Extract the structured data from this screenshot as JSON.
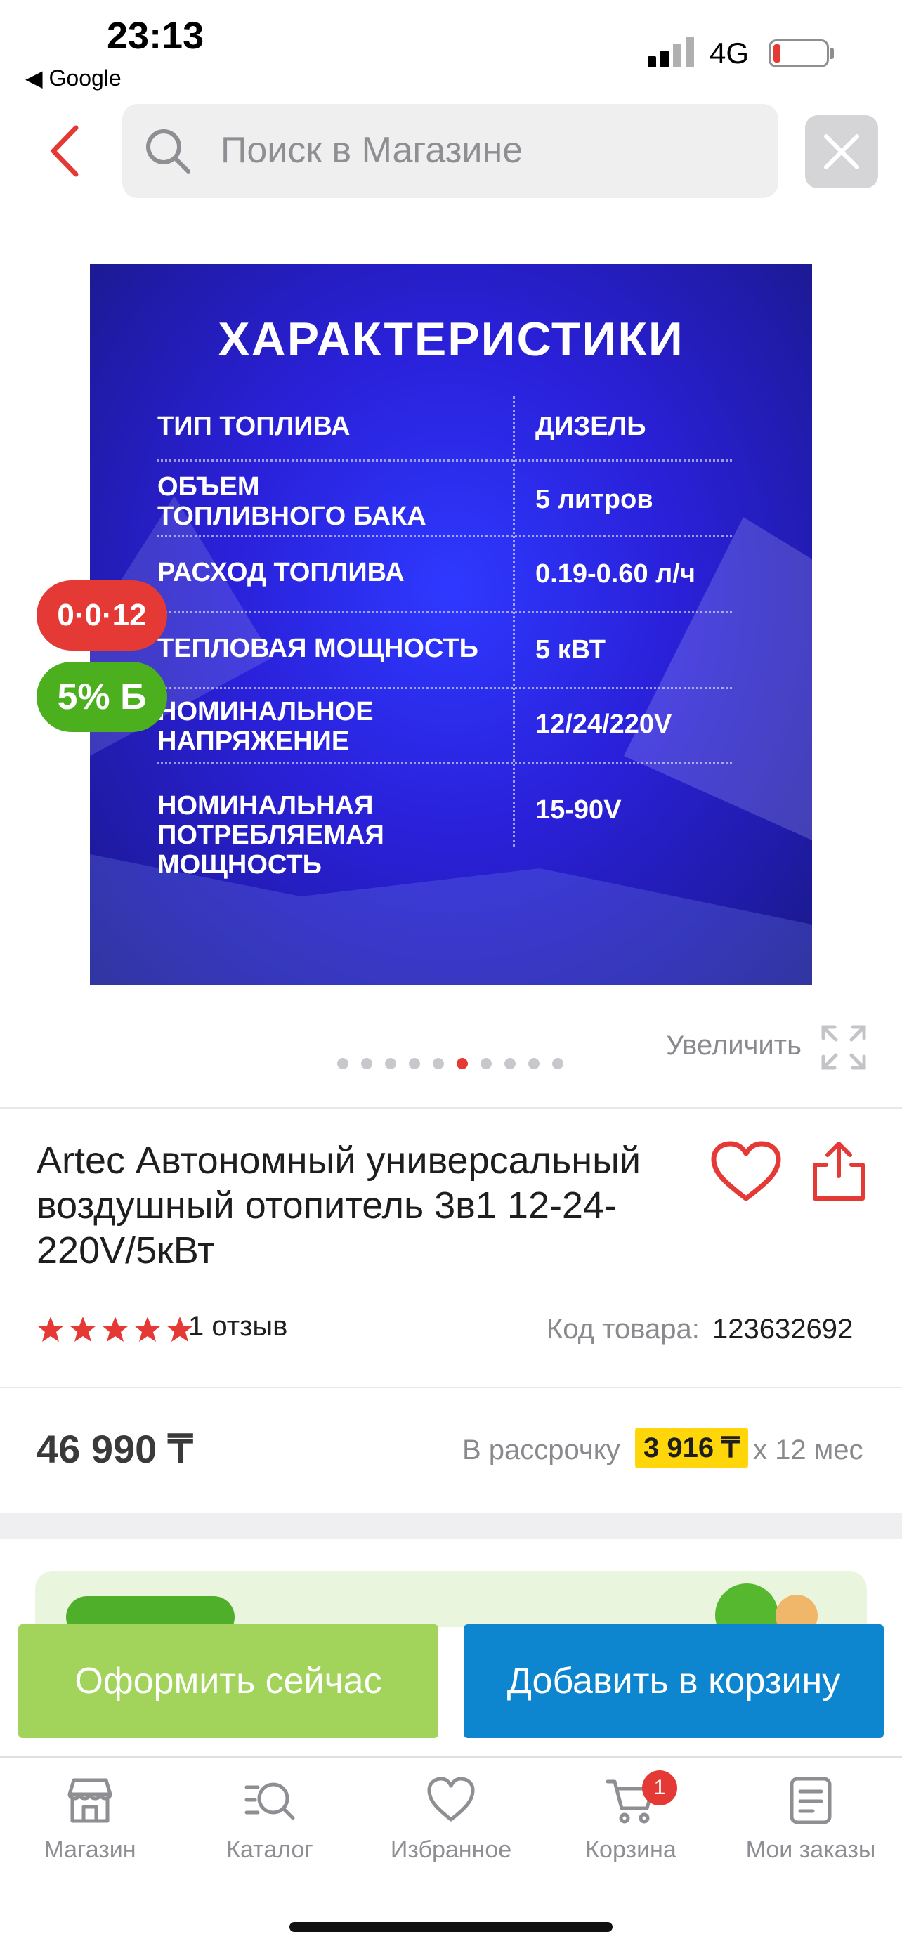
{
  "status_bar": {
    "time": "23:13",
    "back_app": "◀ Google",
    "network": "4G"
  },
  "search": {
    "placeholder": "Поиск в Магазине"
  },
  "product_image": {
    "title": "ХАРАКТЕРИСТИКИ",
    "specs": [
      {
        "name": "ТИП ТОПЛИВА",
        "value": "ДИЗЕЛЬ"
      },
      {
        "name": "ОБЪЕМ\nТОПЛИВНОГО БАКА",
        "value": "5 литров"
      },
      {
        "name": "РАСХОД ТОПЛИВА",
        "value": "0.19-0.60 л/ч"
      },
      {
        "name": "ТЕПЛОВАЯ МОЩНОСТЬ",
        "value": "5 кВТ"
      },
      {
        "name": "НОМИНАЛЬНОЕ\nНАПРЯЖЕНИЕ",
        "value": "12/24/220V"
      },
      {
        "name": "НОМИНАЛЬНАЯ\nПОТРЕБЛЯЕМАЯ\nМОЩНОСТЬ",
        "value": "15-90V"
      }
    ]
  },
  "badges": {
    "installment": "0·0·12",
    "bonus": "5% Б"
  },
  "gallery": {
    "zoom_label": "Увеличить",
    "total": 10,
    "active": 5
  },
  "product": {
    "title": "Artec Автономный универсальный воздушный отопитель 3в1 12-24-220V/5кВт",
    "rating": 5,
    "reviews": "1 отзыв",
    "code_label": "Код товара:",
    "code": "123632692",
    "price": "46 990 ₸",
    "installment_label": "В рассрочку",
    "installment_value": "3 916 ₸",
    "installment_term": "x 12 мес"
  },
  "actions": {
    "buy_now": "Оформить сейчас",
    "add_to_cart": "Добавить в корзину"
  },
  "tabbar": [
    {
      "label": "Магазин",
      "icon": "store-icon"
    },
    {
      "label": "Каталог",
      "icon": "catalog-search-icon"
    },
    {
      "label": "Избранное",
      "icon": "heart-icon"
    },
    {
      "label": "Корзина",
      "icon": "cart-icon",
      "badge": "1"
    },
    {
      "label": "Мои заказы",
      "icon": "orders-icon"
    }
  ],
  "colors": {
    "accent": "#e53935",
    "buy": "#a2d35a",
    "cart": "#0d86cf",
    "installment_highlight": "#ffd60a"
  }
}
